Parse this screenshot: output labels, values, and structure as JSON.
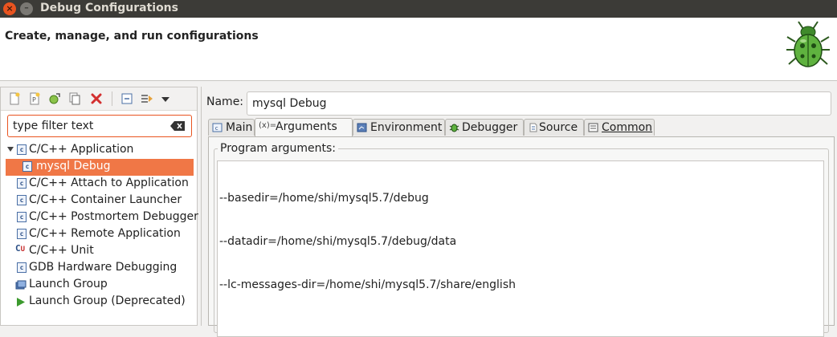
{
  "window": {
    "title": "Debug Configurations"
  },
  "header": {
    "title": "Create, manage, and run configurations"
  },
  "toolbar": {
    "icons": [
      "new-config-icon",
      "new-prototype-icon",
      "export-icon",
      "duplicate-icon",
      "delete-icon",
      "collapse-all-icon",
      "filter-icon",
      "view-menu-icon"
    ],
    "delete_color": "#d32f2f"
  },
  "filter": {
    "value": "type filter text"
  },
  "tree": {
    "group_label": "C/C++ Application",
    "selected_child": "mysql Debug",
    "items": [
      "C/C++ Attach to Application",
      "C/C++ Container Launcher",
      "C/C++ Postmortem Debugger",
      "C/C++ Remote Application",
      "C/C++ Unit",
      "GDB Hardware Debugging",
      "Launch Group",
      "Launch Group (Deprecated)"
    ]
  },
  "name": {
    "label": "Name:",
    "value": "mysql Debug"
  },
  "tabs": [
    "Main",
    "Arguments",
    "Environment",
    "Debugger",
    "Source",
    "Common"
  ],
  "active_tab": "Arguments",
  "arguments": {
    "group_label": "Program arguments:",
    "lines": [
      "--basedir=/home/shi/mysql5.7/debug",
      "--datadir=/home/shi/mysql5.7/debug/data",
      "--lc-messages-dir=/home/shi/mysql5.7/share/english"
    ]
  },
  "colors": {
    "accent": "#e95420",
    "selection": "#f07746",
    "titlebar": "#3c3b37"
  }
}
